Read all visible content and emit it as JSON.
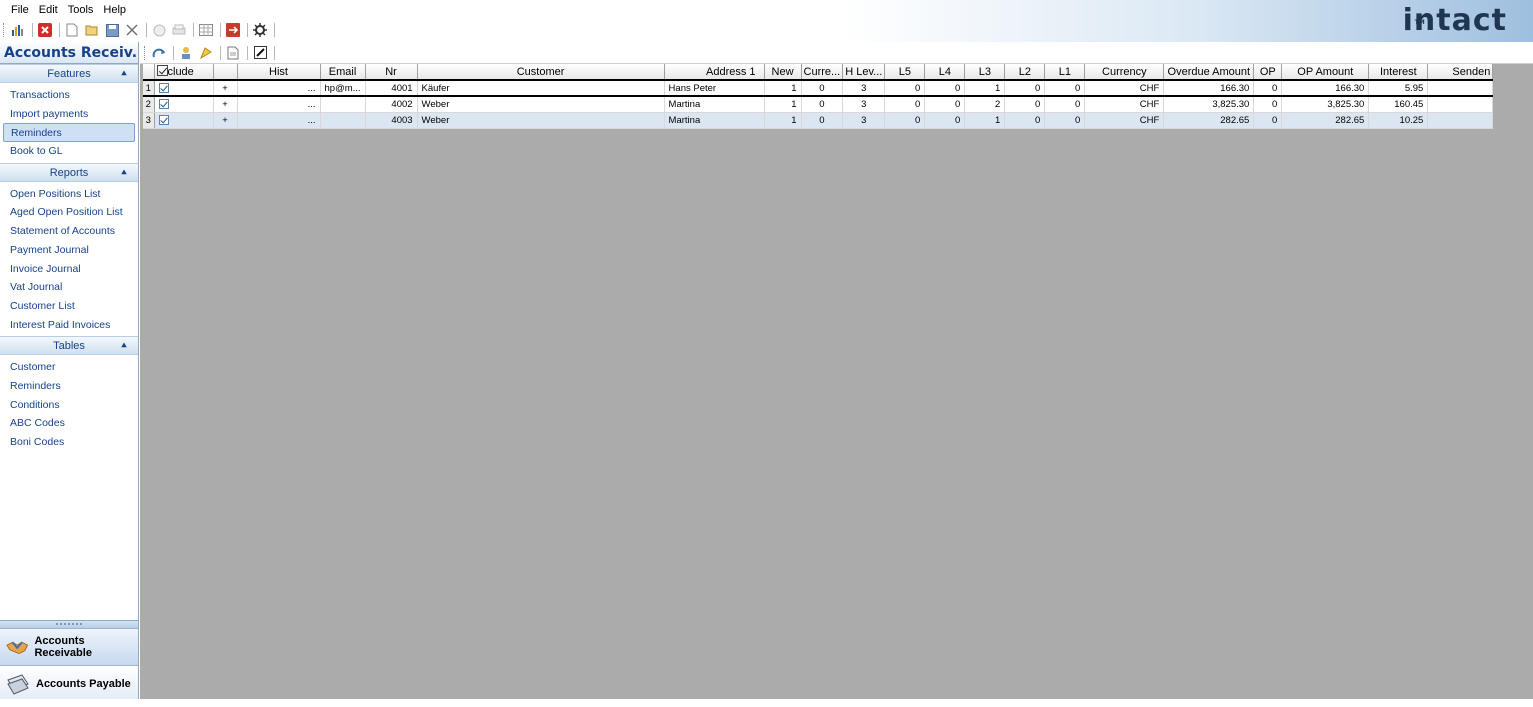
{
  "menu": [
    "File",
    "Edit",
    "Tools",
    "Help"
  ],
  "toolbar_icons": [
    "chart-icon",
    "close-red-icon",
    "new-doc-icon",
    "open-folder-icon",
    "save-icon",
    "delete-x-icon",
    "disabled-print-icon",
    "disabled-print-icon-2",
    "grid-icon",
    "export-red-icon",
    "settings-gear-icon"
  ],
  "logo": {
    "text": "intact",
    "tm": "TM"
  },
  "left_pane": {
    "title": "Accounts Receiv...",
    "groups": [
      {
        "header": "Features",
        "items": [
          "Transactions",
          "Import payments",
          "Reminders",
          "Book to GL"
        ],
        "selected": "Reminders"
      },
      {
        "header": "Reports",
        "items": [
          "Open Positions List",
          "Aged Open Position List",
          "Statement of Accounts",
          "Payment Journal",
          "Invoice Journal",
          "Vat Journal",
          "Customer List",
          "Interest Paid Invoices"
        ]
      },
      {
        "header": "Tables",
        "items": [
          "Customer",
          "Reminders",
          "Conditions",
          "ABC Codes",
          "Boni Codes"
        ]
      }
    ],
    "big_nav": [
      "Accounts Receivable",
      "Accounts Payable"
    ]
  },
  "content_toolbar_icons": [
    "refresh-icon",
    "filter-icon",
    "highlight-icon",
    "document-icon",
    "edit-icon"
  ],
  "grid": {
    "columns": [
      "clude",
      "",
      "Hist",
      "Email",
      "Nr",
      "Customer",
      "Address 1",
      "New",
      "Curre...",
      "H Lev...",
      "L5",
      "L4",
      "L3",
      "L2",
      "L1",
      "Currency",
      "Overdue Amount",
      "OP",
      "OP Amount",
      "Interest",
      "Senden"
    ],
    "rows": [
      {
        "rownum": "1",
        "include": true,
        "plus": "+",
        "hist": "...",
        "email": "hp@m...",
        "nr": "4001",
        "customer": "Käufer",
        "address1": "Hans Peter",
        "new": "1",
        "curr": "0",
        "hlev": "3",
        "l5": "0",
        "l4": "0",
        "l3": "1",
        "l2": "0",
        "l1": "0",
        "currency": "CHF",
        "overdue": "166.30",
        "op": "0",
        "op_amount": "166.30",
        "interest": "5.95",
        "senden": ""
      },
      {
        "rownum": "2",
        "include": true,
        "plus": "+",
        "hist": "...",
        "email": "",
        "nr": "4002",
        "customer": "Weber",
        "address1": "Martina",
        "new": "1",
        "curr": "0",
        "hlev": "3",
        "l5": "0",
        "l4": "0",
        "l3": "2",
        "l2": "0",
        "l1": "0",
        "currency": "CHF",
        "overdue": "3,825.30",
        "op": "0",
        "op_amount": "3,825.30",
        "interest": "160.45",
        "senden": ""
      },
      {
        "rownum": "3",
        "include": true,
        "plus": "+",
        "hist": "...",
        "email": "",
        "nr": "4003",
        "customer": "Weber",
        "address1": "Martina",
        "new": "1",
        "curr": "0",
        "hlev": "3",
        "l5": "0",
        "l4": "0",
        "l3": "1",
        "l2": "0",
        "l1": "0",
        "currency": "CHF",
        "overdue": "282.65",
        "op": "0",
        "op_amount": "282.65",
        "interest": "10.25",
        "senden": ""
      }
    ]
  },
  "colors": {
    "nav_text": "#15428b",
    "grid_bg": "#ababab",
    "selected_row": "#dce6f3",
    "logo": "#1f3550"
  }
}
